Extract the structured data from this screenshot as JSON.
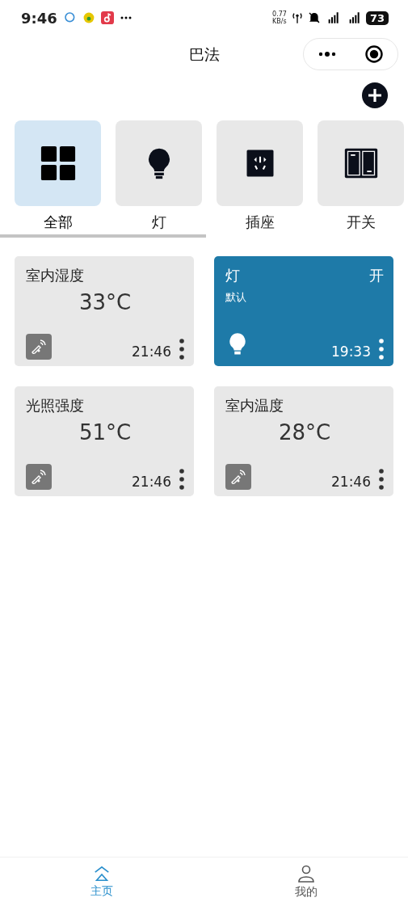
{
  "status_bar": {
    "time": "9:46",
    "speed": "0.77",
    "speed_unit": "KB/s",
    "battery": "73"
  },
  "nav_bar": {
    "title": "巴法"
  },
  "categories": [
    {
      "label": "全部",
      "kind": "all",
      "selected": true
    },
    {
      "label": "灯",
      "kind": "bulb",
      "selected": false
    },
    {
      "label": "插座",
      "kind": "socket",
      "selected": false
    },
    {
      "label": "开关",
      "kind": "switch",
      "selected": false
    }
  ],
  "devices": [
    {
      "kind": "sensor",
      "name": "室内湿度",
      "value": "33°C",
      "time": "21:46"
    },
    {
      "kind": "light",
      "name": "灯",
      "state_text": "开",
      "subtitle": "默认",
      "on": true,
      "time": "19:33"
    },
    {
      "kind": "sensor",
      "name": "光照强度",
      "value": "51°C",
      "time": "21:46"
    },
    {
      "kind": "sensor",
      "name": "室内温度",
      "value": "28°C",
      "time": "21:46"
    }
  ],
  "tab_bar": [
    {
      "label": "主页",
      "kind": "home",
      "selected": true
    },
    {
      "label": "我的",
      "kind": "user",
      "selected": false
    }
  ]
}
